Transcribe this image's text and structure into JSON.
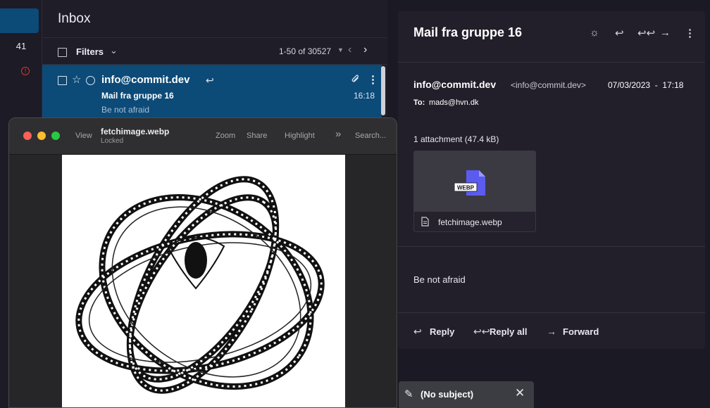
{
  "nav": {
    "unread_count": "41",
    "alert_icon": "alert-circle-icon"
  },
  "inbox": {
    "title": "Inbox",
    "filters_label": "Filters",
    "range": "1-50 of 30527",
    "message": {
      "sender": "info@commit.dev",
      "subject": "Mail fra gruppe 16",
      "time": "16:18",
      "preview": "Be not afraid"
    }
  },
  "reading_pane": {
    "subject": "Mail fra gruppe 16",
    "toolbar_icons": [
      "theme-sun-icon",
      "reply-icon",
      "reply-all-icon",
      "forward-icon",
      "more-icon"
    ],
    "from_name": "info@commit.dev",
    "from_address": "<info@commit.dev>",
    "date": "07/03/2023  -  17:18",
    "to_label": "To:",
    "to": "mads@hvn.dk",
    "attachment_count": "1 attachment (47.4 kB)",
    "attachment": {
      "type_badge": "WEBP",
      "filename": "fetchimage.webp"
    },
    "body": "Be not afraid",
    "actions": {
      "reply": "Reply",
      "reply_all": "Reply all",
      "forward": "Forward"
    }
  },
  "draft": {
    "label": "(No subject)"
  },
  "viewer": {
    "view": "View",
    "filename": "fetchimage.webp",
    "status": "Locked",
    "zoom": "Zoom",
    "share": "Share",
    "highlight": "Highlight",
    "search": "Search...",
    "traffic_light_colors": [
      "#fe5f57",
      "#febc2e",
      "#28c840"
    ]
  },
  "colors": {
    "accent": "#0c4a78",
    "file_icon": "#5b5bef"
  }
}
